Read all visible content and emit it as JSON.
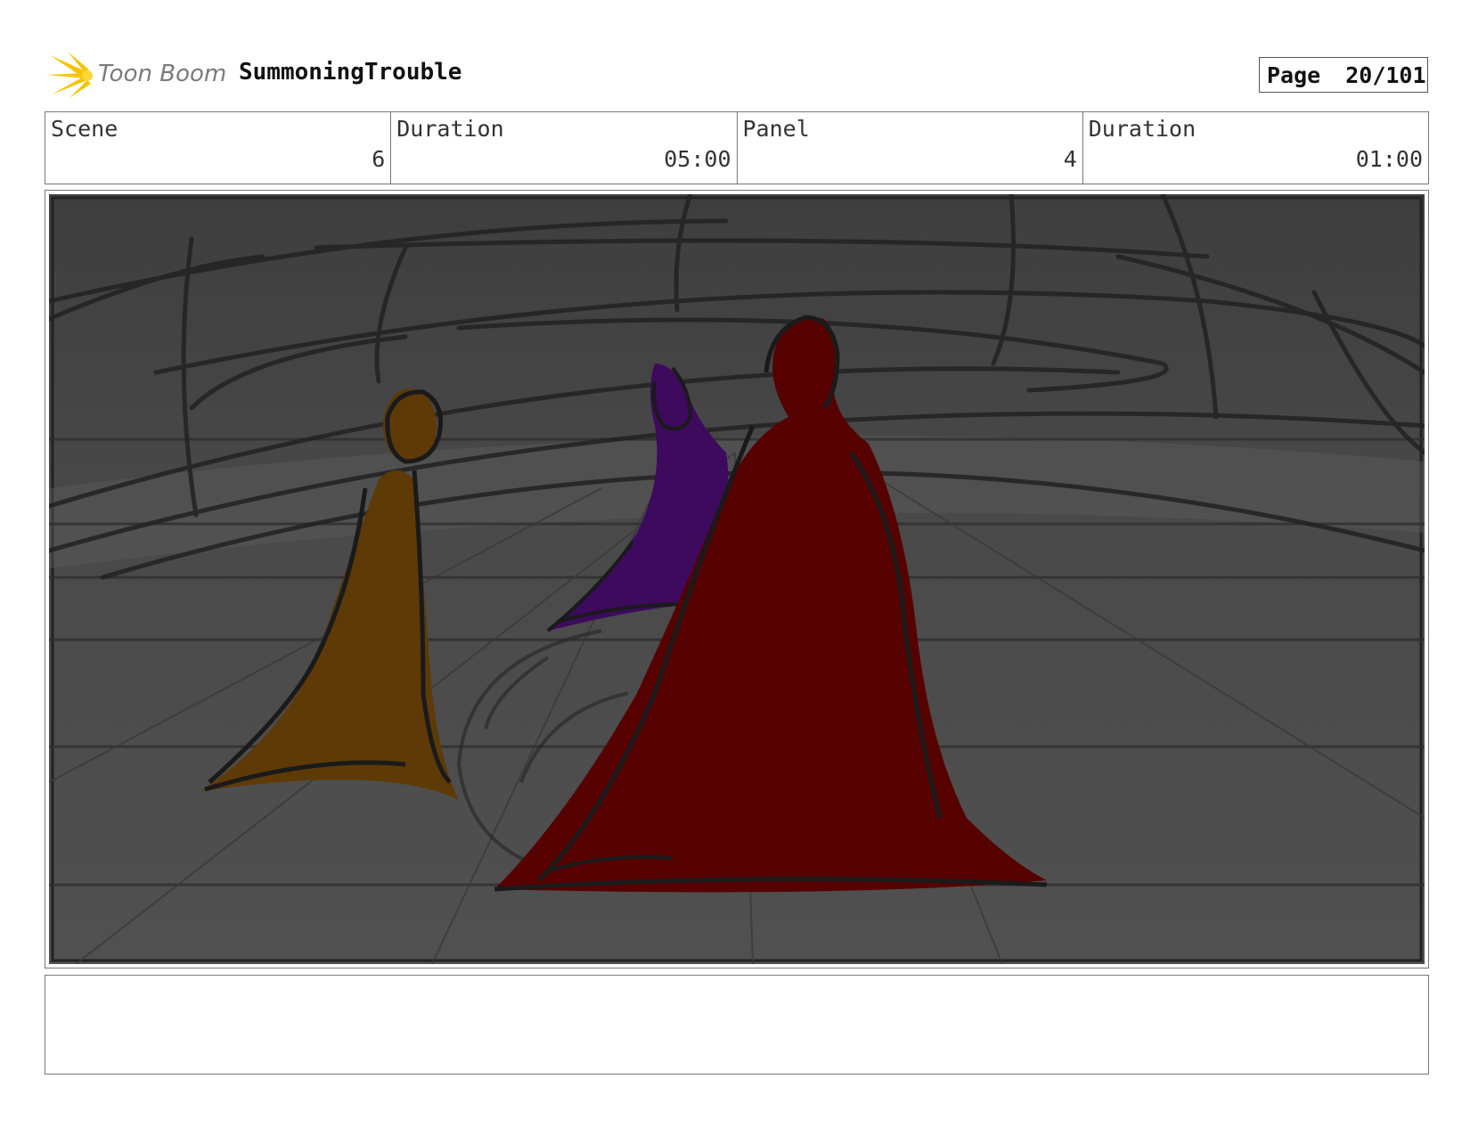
{
  "header": {
    "logo_text": "Toon Boom",
    "project_title": "SummoningTrouble",
    "page_label": "Page",
    "page_value": "20/101"
  },
  "info": {
    "scene_label": "Scene",
    "scene_value": "6",
    "scene_duration_label": "Duration",
    "scene_duration_value": "05:00",
    "panel_label": "Panel",
    "panel_value": "4",
    "panel_duration_label": "Duration",
    "panel_duration_value": "01:00"
  },
  "colors": {
    "background_gray": "#4a4a4a",
    "orange_figure": "#5e3a06",
    "purple_figure": "#3d0a5e",
    "red_figure": "#560000",
    "logo_yellow": "#f5c400"
  },
  "notes": {
    "text": ""
  }
}
